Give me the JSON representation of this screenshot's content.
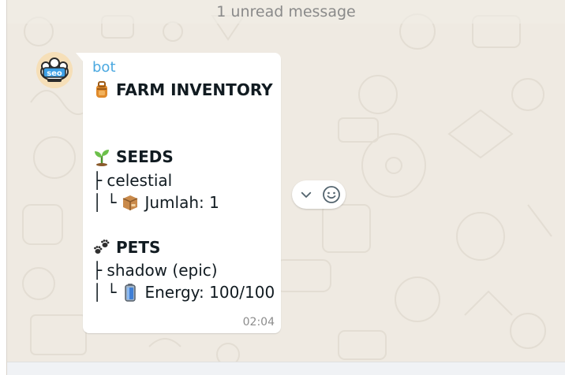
{
  "chat": {
    "unread_banner": "1 unread message"
  },
  "message": {
    "sender": "bot",
    "title": "FARM INVENTORY",
    "seeds_header": "SEEDS",
    "seed_item": "├ celestial",
    "seed_qty_prefix": "│ └",
    "seed_qty": "Jumlah: 1",
    "pets_header": "PETS",
    "pet_item": "├ shadow (epic)",
    "pet_energy_prefix": "│ └",
    "pet_energy": "Energy: 100/100",
    "time": "02:04"
  },
  "avatar": {
    "logo_text": "seo"
  },
  "icons": {
    "title": "backpack-icon",
    "seeds": "seedling-icon",
    "qty": "package-icon",
    "pets": "paw-prints-icon",
    "energy": "battery-icon",
    "react_menu": "chevron-down-icon",
    "react_emoji": "smiley-icon"
  },
  "colors": {
    "chat_bg": "#efeae2",
    "bubble": "#ffffff",
    "sender": "#4aa8e0",
    "text": "#111b21",
    "meta": "#8c8c8c"
  }
}
